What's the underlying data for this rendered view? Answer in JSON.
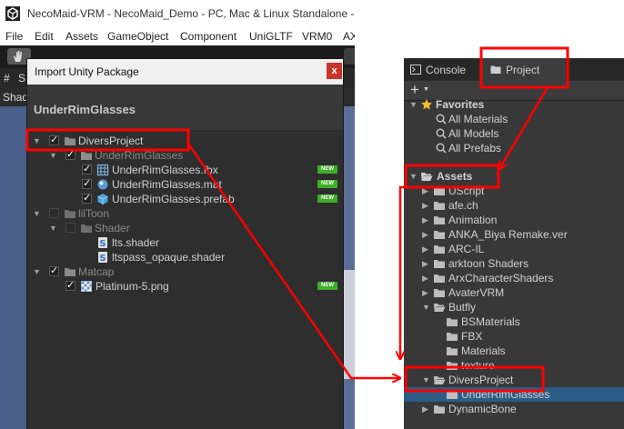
{
  "window": {
    "title": "NecoMaid-VRM - NecoMaid_Demo - PC, Mac & Linux Standalone - <"
  },
  "menu": [
    "File",
    "Edit",
    "Assets",
    "GameObject",
    "Component",
    "UniGLTF",
    "VRM0",
    "AX"
  ],
  "scene": {
    "tab_label": "S",
    "strip_label": "Shad"
  },
  "dialog": {
    "title": "Import Unity Package",
    "close_label": "x",
    "package_name": "UnderRimGlasses",
    "new_badge": "NEW",
    "items": [
      {
        "label": "DiversProject",
        "icon": "folder-icon",
        "checked": true,
        "dim": false,
        "new": false
      },
      {
        "label": "UnderRimGlasses",
        "icon": "folder-icon",
        "checked": true,
        "dim": true,
        "new": false
      },
      {
        "label": "UnderRimGlasses.fbx",
        "icon": "fbx-grid-icon",
        "checked": true,
        "dim": false,
        "new": true
      },
      {
        "label": "UnderRimGlasses.mat",
        "icon": "material-sphere-icon",
        "checked": true,
        "dim": false,
        "new": true
      },
      {
        "label": "UnderRimGlasses.prefab",
        "icon": "prefab-cube-icon",
        "checked": true,
        "dim": false,
        "new": true
      },
      {
        "label": "lilToon",
        "icon": "folder-icon",
        "checked": false,
        "dim": true,
        "new": false
      },
      {
        "label": "Shader",
        "icon": "folder-icon",
        "checked": false,
        "dim": true,
        "new": false
      },
      {
        "label": "lts.shader",
        "icon": "shader-icon",
        "checked": false,
        "dim": false,
        "new": false
      },
      {
        "label": "ltspass_opaque.shader",
        "icon": "shader-icon",
        "checked": false,
        "dim": false,
        "new": false
      },
      {
        "label": "Matcap",
        "icon": "folder-icon",
        "checked": true,
        "dim": true,
        "new": false
      },
      {
        "label": "Platinum-5.png",
        "icon": "texture-icon",
        "checked": true,
        "dim": false,
        "new": true
      }
    ]
  },
  "project_panel": {
    "tabs": [
      {
        "label": "Console",
        "icon": "console-icon"
      },
      {
        "label": "Project",
        "icon": "folder-icon"
      }
    ],
    "add_label": "+",
    "favorites": {
      "label": "Favorites",
      "items": [
        "All Materials",
        "All Models",
        "All Prefabs"
      ]
    },
    "assets": {
      "label": "Assets",
      "items": [
        {
          "label": "UScript",
          "expanded": false,
          "depth": 1
        },
        {
          "label": "afe.ch",
          "expanded": false,
          "depth": 1
        },
        {
          "label": "Animation",
          "expanded": false,
          "depth": 1
        },
        {
          "label": "ANKA_Biya Remake.ver",
          "expanded": false,
          "depth": 1
        },
        {
          "label": "ARC-IL",
          "expanded": false,
          "depth": 1
        },
        {
          "label": "arktoon Shaders",
          "expanded": false,
          "depth": 1
        },
        {
          "label": "ArxCharacterShaders",
          "expanded": false,
          "depth": 1
        },
        {
          "label": "AvaterVRM",
          "expanded": false,
          "depth": 1
        },
        {
          "label": "Butfly",
          "expanded": true,
          "depth": 1
        },
        {
          "label": "BSMaterials",
          "expanded": false,
          "depth": 2
        },
        {
          "label": "FBX",
          "expanded": false,
          "depth": 2
        },
        {
          "label": "Materials",
          "expanded": false,
          "depth": 2
        },
        {
          "label": "texture",
          "expanded": false,
          "depth": 2
        },
        {
          "label": "DiversProject",
          "expanded": true,
          "depth": 1
        },
        {
          "label": "UnderRimGlasses",
          "expanded": false,
          "depth": 2,
          "selected": true
        },
        {
          "label": "DynamicBone",
          "expanded": false,
          "depth": 1
        }
      ]
    }
  },
  "colors": {
    "annotation_red": "#ff0000",
    "new_badge_green": "#3fae2a",
    "selection_blue": "#2c5d87",
    "favorites_star": "#f0c030"
  }
}
